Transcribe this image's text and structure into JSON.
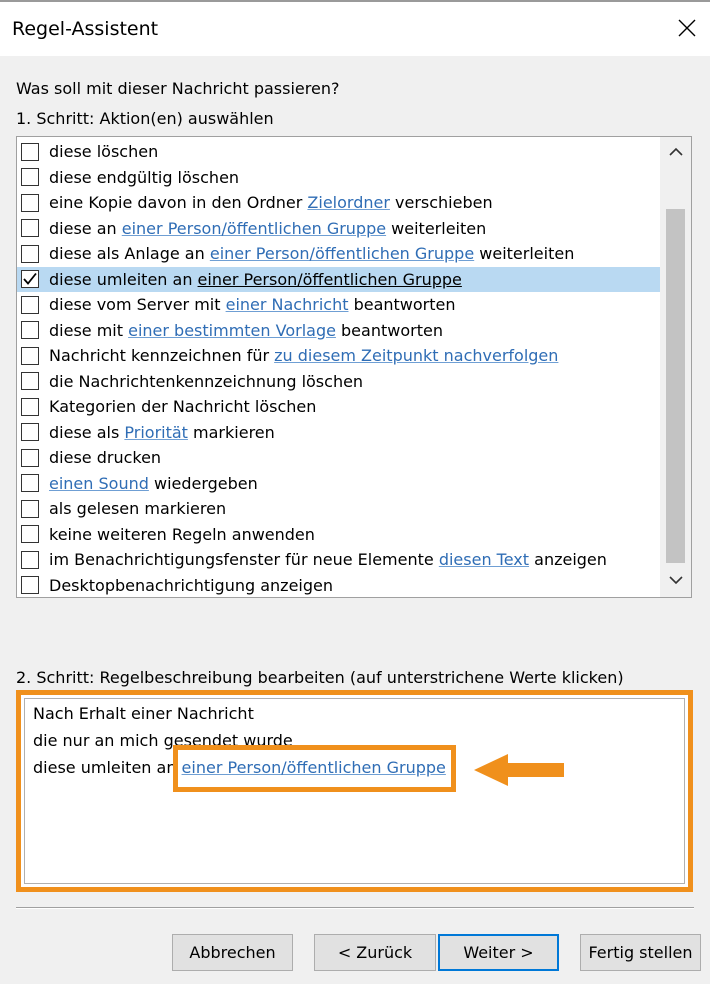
{
  "window": {
    "title": "Regel-Assistent"
  },
  "prompt": "Was soll mit dieser Nachricht passieren?",
  "step1_label": "1. Schritt: Aktion(en) auswählen",
  "actions": [
    {
      "checked": false,
      "parts": [
        {
          "t": "diese löschen",
          "link": false
        }
      ]
    },
    {
      "checked": false,
      "parts": [
        {
          "t": "diese endgültig löschen",
          "link": false
        }
      ]
    },
    {
      "checked": false,
      "parts": [
        {
          "t": "eine Kopie davon in den Ordner ",
          "link": false
        },
        {
          "t": "Zielordner",
          "link": true
        },
        {
          "t": " verschieben",
          "link": false
        }
      ]
    },
    {
      "checked": false,
      "parts": [
        {
          "t": "diese an ",
          "link": false
        },
        {
          "t": "einer Person/öffentlichen Gruppe",
          "link": true
        },
        {
          "t": " weiterleiten",
          "link": false
        }
      ]
    },
    {
      "checked": false,
      "parts": [
        {
          "t": "diese als Anlage an ",
          "link": false
        },
        {
          "t": "einer Person/öffentlichen Gruppe",
          "link": true
        },
        {
          "t": " weiterleiten",
          "link": false
        }
      ]
    },
    {
      "checked": true,
      "selected": true,
      "parts": [
        {
          "t": "diese umleiten an ",
          "link": false
        },
        {
          "t": "einer Person/öffentlichen Gruppe",
          "link": false,
          "underline": true
        }
      ]
    },
    {
      "checked": false,
      "parts": [
        {
          "t": "diese vom Server mit ",
          "link": false
        },
        {
          "t": "einer Nachricht",
          "link": true
        },
        {
          "t": " beantworten",
          "link": false
        }
      ]
    },
    {
      "checked": false,
      "parts": [
        {
          "t": "diese mit ",
          "link": false
        },
        {
          "t": "einer bestimmten Vorlage",
          "link": true
        },
        {
          "t": " beantworten",
          "link": false
        }
      ]
    },
    {
      "checked": false,
      "parts": [
        {
          "t": "Nachricht kennzeichnen für ",
          "link": false
        },
        {
          "t": "zu diesem Zeitpunkt nachverfolgen",
          "link": true
        }
      ]
    },
    {
      "checked": false,
      "parts": [
        {
          "t": "die Nachrichtenkennzeichnung löschen",
          "link": false
        }
      ]
    },
    {
      "checked": false,
      "parts": [
        {
          "t": "Kategorien der Nachricht löschen",
          "link": false
        }
      ]
    },
    {
      "checked": false,
      "parts": [
        {
          "t": "diese als ",
          "link": false
        },
        {
          "t": "Priorität",
          "link": true
        },
        {
          "t": " markieren",
          "link": false
        }
      ]
    },
    {
      "checked": false,
      "parts": [
        {
          "t": "diese drucken",
          "link": false
        }
      ]
    },
    {
      "checked": false,
      "parts": [
        {
          "t": "einen Sound",
          "link": true
        },
        {
          "t": " wiedergeben",
          "link": false
        }
      ]
    },
    {
      "checked": false,
      "parts": [
        {
          "t": "als gelesen markieren",
          "link": false
        }
      ]
    },
    {
      "checked": false,
      "parts": [
        {
          "t": "keine weiteren Regeln anwenden",
          "link": false
        }
      ]
    },
    {
      "checked": false,
      "parts": [
        {
          "t": "im Benachrichtigungsfenster für neue Elemente ",
          "link": false
        },
        {
          "t": "diesen Text",
          "link": true
        },
        {
          "t": " anzeigen",
          "link": false
        }
      ]
    },
    {
      "checked": false,
      "parts": [
        {
          "t": "Desktopbenachrichtigung anzeigen",
          "link": false
        }
      ]
    }
  ],
  "step2_label": "2. Schritt: Regelbeschreibung bearbeiten (auf unterstrichene Werte klicken)",
  "description": {
    "line1": "Nach Erhalt einer Nachricht",
    "line2": "die nur an mich gesendet wurde",
    "line3_prefix": "diese umleiten an ",
    "line3_link": "einer Person/öffentlichen Gruppe"
  },
  "buttons": {
    "cancel": "Abbrechen",
    "back": "< Zurück",
    "next": "Weiter >",
    "finish": "Fertig stellen"
  },
  "colors": {
    "annotation": "#f0901c",
    "link": "#2f6db5",
    "selection": "#b9d9f2"
  }
}
